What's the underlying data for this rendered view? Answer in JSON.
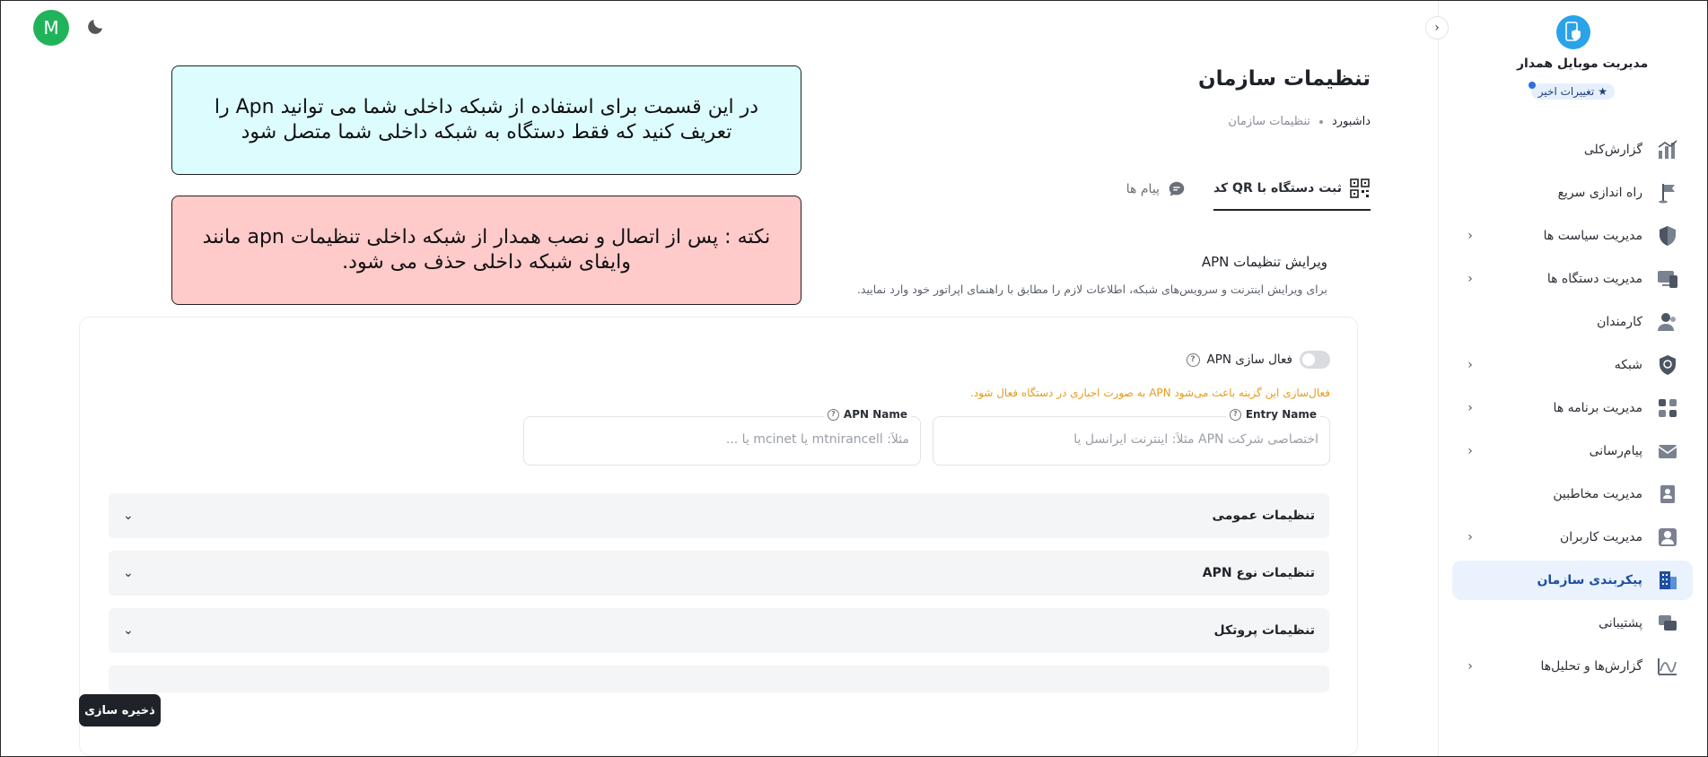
{
  "sidebar": {
    "brand_name": "مدیریت موبایل همدار",
    "recent_changes": "تغییرات اخیر",
    "items": [
      {
        "label": "گزارش‌کلی",
        "icon": "chart-icon",
        "has_children": false
      },
      {
        "label": "راه اندازی سریع",
        "icon": "flag-icon",
        "has_children": false
      },
      {
        "label": "مدیریت سیاست ها",
        "icon": "shield-icon",
        "has_children": true
      },
      {
        "label": "مدیریت دستگاه ها",
        "icon": "devices-icon",
        "has_children": true
      },
      {
        "label": "کارمندان",
        "icon": "users-icon",
        "has_children": false
      },
      {
        "label": "شبکه",
        "icon": "network-shield-icon",
        "has_children": true
      },
      {
        "label": "مدیریت برنامه ها",
        "icon": "apps-icon",
        "has_children": true
      },
      {
        "label": "پیام‌رسانی",
        "icon": "mail-icon",
        "has_children": true
      },
      {
        "label": "مدیریت مخاطبین",
        "icon": "contacts-icon",
        "has_children": false
      },
      {
        "label": "مدیریت کاربران",
        "icon": "user-card-icon",
        "has_children": true
      },
      {
        "label": "پیکربندی سازمان",
        "icon": "building-icon",
        "has_children": false,
        "active": true
      },
      {
        "label": "پشتیبانی",
        "icon": "support-icon",
        "has_children": false
      },
      {
        "label": "گزارش‌ها و تحلیل‌ها",
        "icon": "analytics-icon",
        "has_children": true
      }
    ]
  },
  "user": {
    "initial": "M"
  },
  "notes": {
    "info": "در این قسمت برای استفاده از شبکه داخلی شما می توانید Apn را تعریف کنید که فقط دستگاه به شبکه داخلی شما متصل شود",
    "warning": "نکته : پس از اتصال و نصب همدار از شبکه داخلی تنظیمات apn مانند وایفای شبکه داخلی حذف می شود."
  },
  "page": {
    "title": "تنظیمات سازمان",
    "breadcrumb_home": "داشبورد",
    "breadcrumb_current": "تنظیمات سازمان"
  },
  "tabs": [
    {
      "label": "ثبت دستگاه با QR کد",
      "icon": "qr-code-icon",
      "active": true
    },
    {
      "label": "پیام ها",
      "icon": "chat-icon",
      "active": false
    }
  ],
  "apn": {
    "section_title": "ویرایش تنظیمات APN",
    "section_desc": "برای ویرایش اینترنت و سرویس‌های شبکه، اطلاعات لازم را مطابق با راهنمای اپراتور خود وارد نمایید.",
    "toggle_label": "فعال سازی APN",
    "toggle_on": false,
    "warning": "فعال‌سازی این گزینه باعث می‌شود APN به صورت اجباری در دستگاه فعال شود.",
    "entry_name_label": "Entry Name",
    "entry_name_placeholder": "اختصاصی شرکت APN مثلاً: اینترنت ایرانسل یا",
    "apn_name_label": "APN Name",
    "apn_name_placeholder": "مثلاً: mtnirancell یا mcinet یا ...",
    "accordions": [
      "تنظیمات عمومی",
      "تنظیمات نوع APN",
      "تنظیمات پروتکل"
    ]
  },
  "actions": {
    "save": "ذخیره سازی"
  },
  "colors": {
    "accent": "#1d4fa3",
    "active_bg": "#eaf2fd",
    "info_note": "#ddfcfd",
    "warn_note": "#fecaca",
    "warning_text": "#e79a1b",
    "avatar": "#21b35a"
  }
}
